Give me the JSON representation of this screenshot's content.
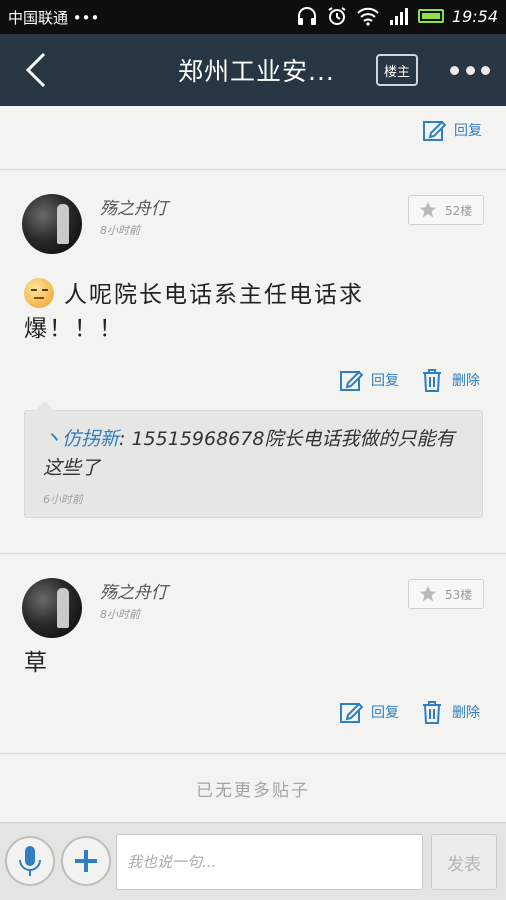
{
  "status_bar": {
    "carrier": "中国联通 •••",
    "time": "19:54"
  },
  "nav": {
    "title": "郑州工业安...",
    "owner_label": "楼主"
  },
  "top_strip": {
    "reply_label": "回复"
  },
  "posts": [
    {
      "author": "殇之舟仃",
      "time": "8小时前",
      "floor": "52楼",
      "content": "人呢院长电话系主任电话求爆！！！",
      "reply_label": "回复",
      "delete_label": "删除",
      "sub_reply": {
        "name": "丶仿拐新",
        "text": "15515968678院长电话我做的只能有这些了",
        "time": "6小时前"
      }
    },
    {
      "author": "殇之舟仃",
      "time": "8小时前",
      "floor": "53楼",
      "content": "草",
      "reply_label": "回复",
      "delete_label": "删除"
    }
  ],
  "no_more": "已无更多贴子",
  "bottom": {
    "input_placeholder": "我也说一句...",
    "send_label": "发表"
  },
  "colors": {
    "nav_bg": "#283542",
    "accent": "#2f7fc4",
    "battery": "#8be24a"
  },
  "icons": [
    "back-arrow-icon",
    "more-dots-icon",
    "edit-icon",
    "trash-icon",
    "star-icon",
    "mic-icon",
    "plus-icon",
    "headphones-icon",
    "alarm-icon",
    "wifi-icon",
    "signal-icon"
  ]
}
